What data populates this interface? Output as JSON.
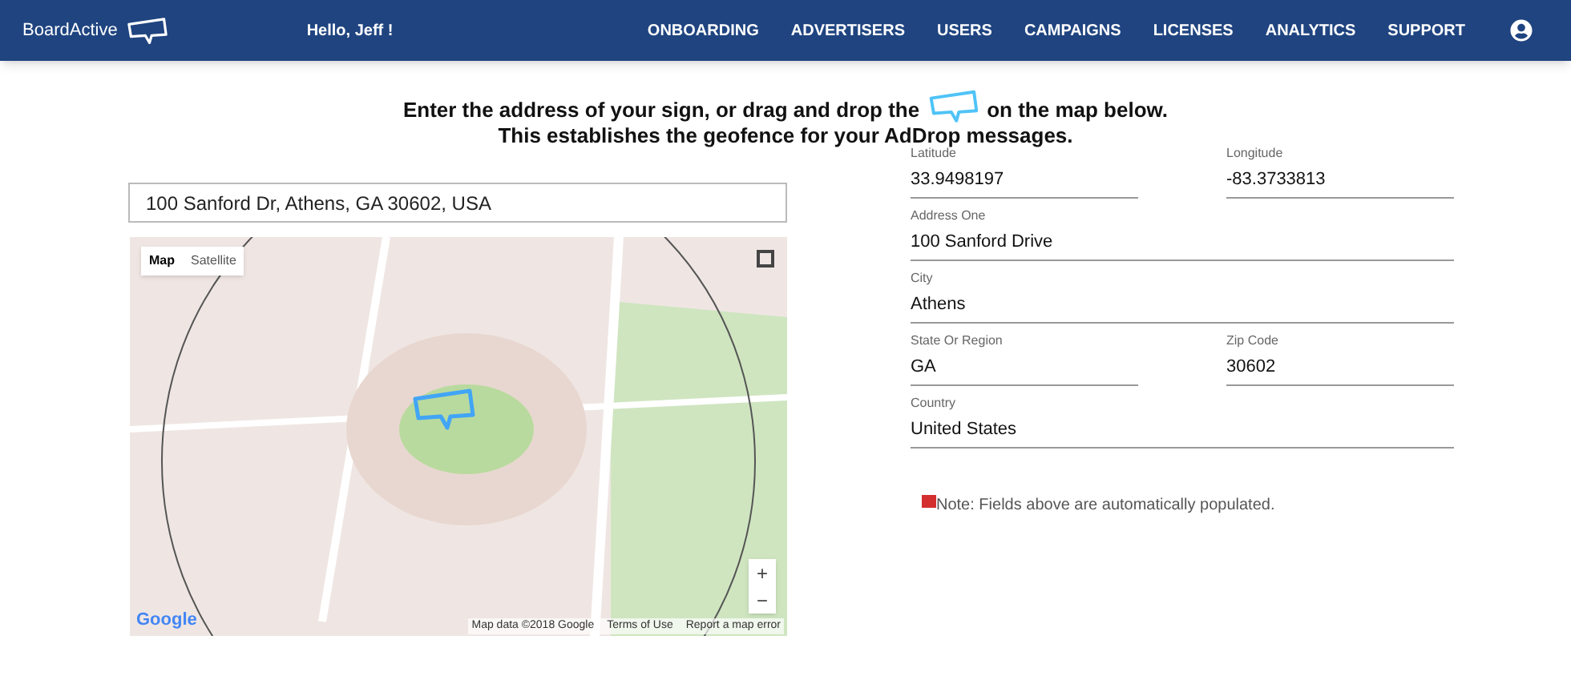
{
  "header": {
    "brand": "BoardActive",
    "greeting": "Hello, Jeff !",
    "nav": [
      {
        "label": "ONBOARDING",
        "selected": false
      },
      {
        "label": "ADVERTISERS",
        "selected": false
      },
      {
        "label": "USERS",
        "selected": false
      },
      {
        "label": "CAMPAIGNS",
        "selected": false
      },
      {
        "label": "LICENSES",
        "selected": false
      },
      {
        "label": "ANALYTICS",
        "selected": false
      },
      {
        "label": "SUPPORT",
        "selected": false
      }
    ]
  },
  "instructions": {
    "line1_before": "Enter the address of your sign, or drag and drop the",
    "line1_after": "on the map below.",
    "line2": "This establishes the geofence for your AdDrop messages."
  },
  "address_search": {
    "value": "100 Sanford Dr, Athens, GA 30602, USA"
  },
  "map": {
    "types": [
      {
        "label": "Map",
        "selected": true
      },
      {
        "label": "Satellite",
        "selected": false
      }
    ],
    "zoom_in": "+",
    "zoom_out": "−",
    "logo": "Google",
    "attribution": [
      "Map data ©2018 Google",
      "Terms of Use",
      "Report a map error"
    ]
  },
  "form": {
    "rows": [
      [
        {
          "label": "Latitude",
          "value": "33.9498197"
        },
        {
          "label": "Longitude",
          "value": "-83.3733813"
        }
      ],
      [
        {
          "label": "Address One",
          "value": "100 Sanford Drive"
        }
      ],
      [
        {
          "label": "City",
          "value": "Athens"
        }
      ],
      [
        {
          "label": "State Or Region",
          "value": "GA"
        },
        {
          "label": "Zip Code",
          "value": "30602"
        }
      ],
      [
        {
          "label": "Country",
          "value": "United States"
        }
      ]
    ],
    "note": "Note: Fields above are automatically populated."
  }
}
